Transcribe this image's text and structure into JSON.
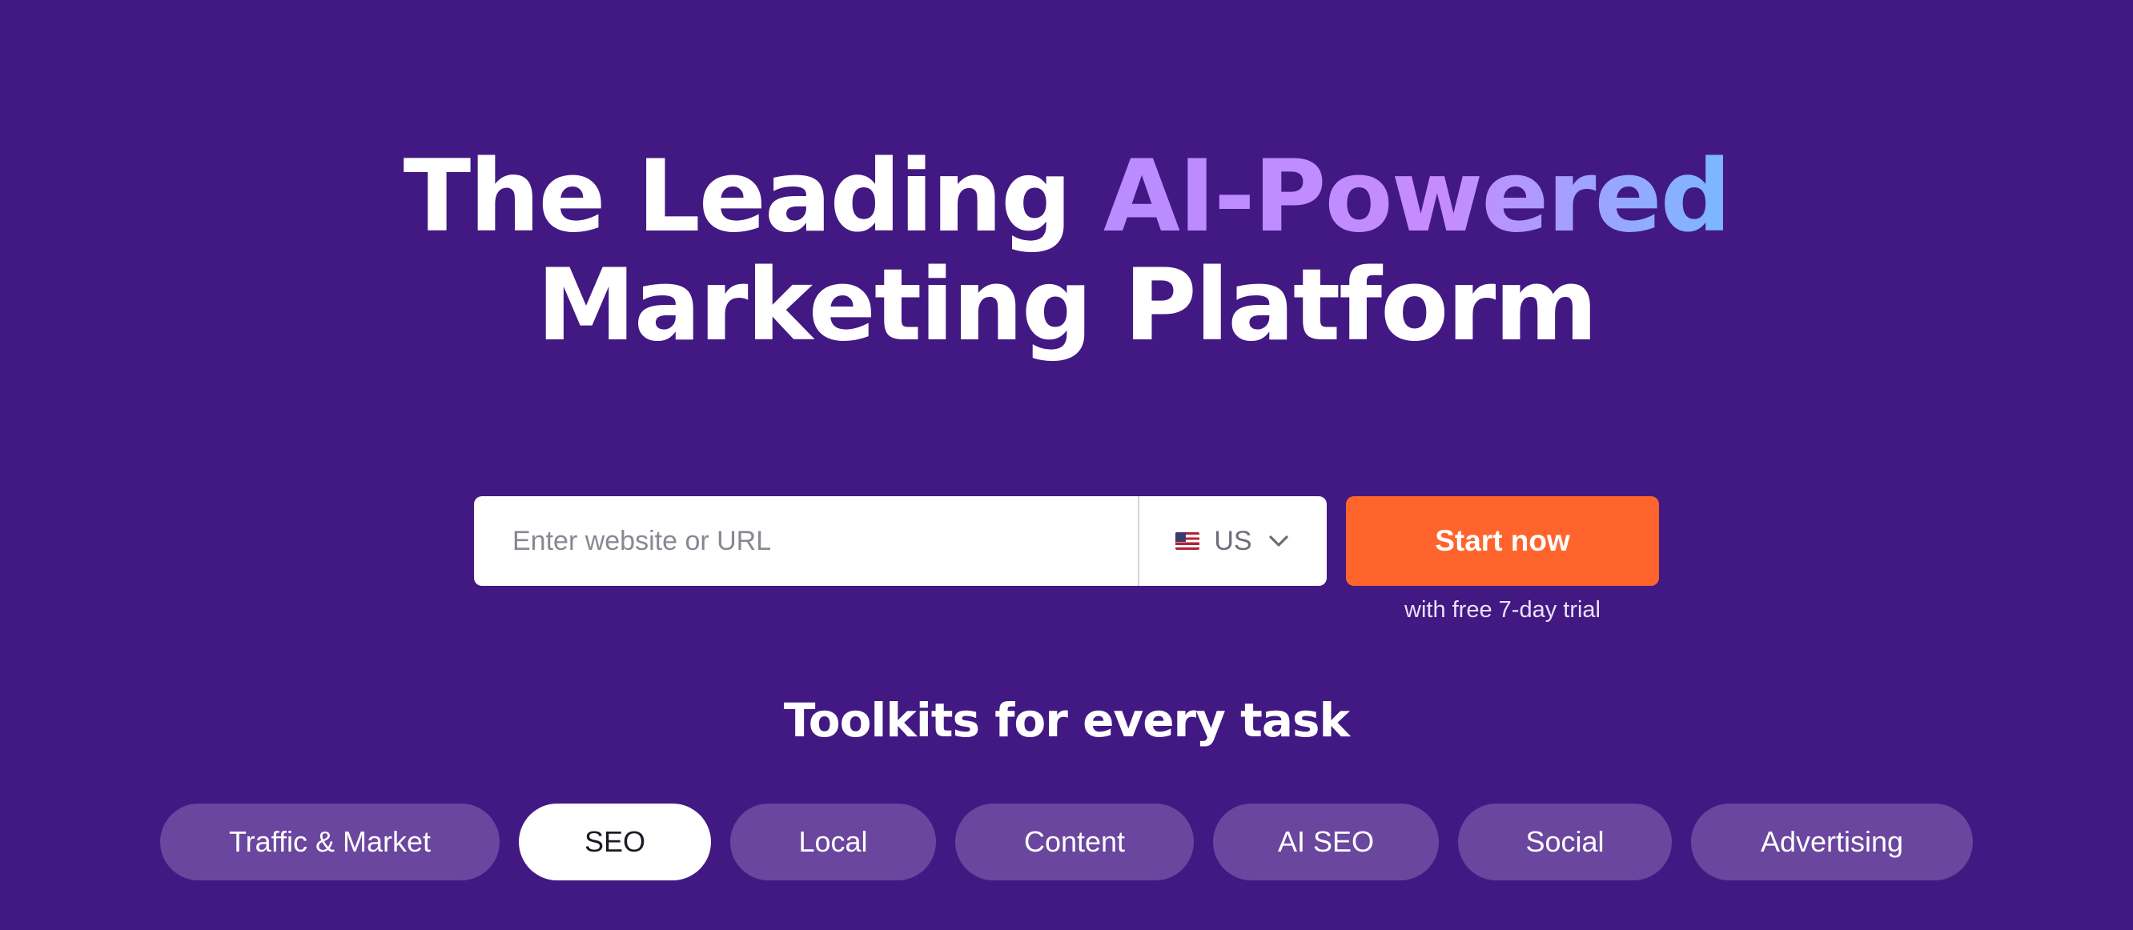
{
  "hero": {
    "title_part1": "The Leading ",
    "title_accent": "AI-Powered",
    "title_line2": "Marketing Platform"
  },
  "search": {
    "placeholder": "Enter website or URL",
    "value": "",
    "country": "US",
    "country_icon": "us-flag-icon",
    "dropdown_icon": "chevron-down-icon"
  },
  "cta": {
    "label": "Start now",
    "note": "with free 7-day trial"
  },
  "toolkits": {
    "heading": "Toolkits for every task",
    "tabs": [
      {
        "label": "Traffic & Market"
      },
      {
        "label": "SEO",
        "active": true
      },
      {
        "label": "Local"
      },
      {
        "label": "Content"
      },
      {
        "label": "AI SEO"
      },
      {
        "label": "Social"
      },
      {
        "label": "Advertising"
      }
    ]
  },
  "colors": {
    "background": "#421983",
    "accent_gradient_start": "#b98cff",
    "accent_gradient_end": "#7ab8ff",
    "cta": "#ff642d",
    "pill_inactive": "#6a469f",
    "pill_active": "#ffffff"
  }
}
